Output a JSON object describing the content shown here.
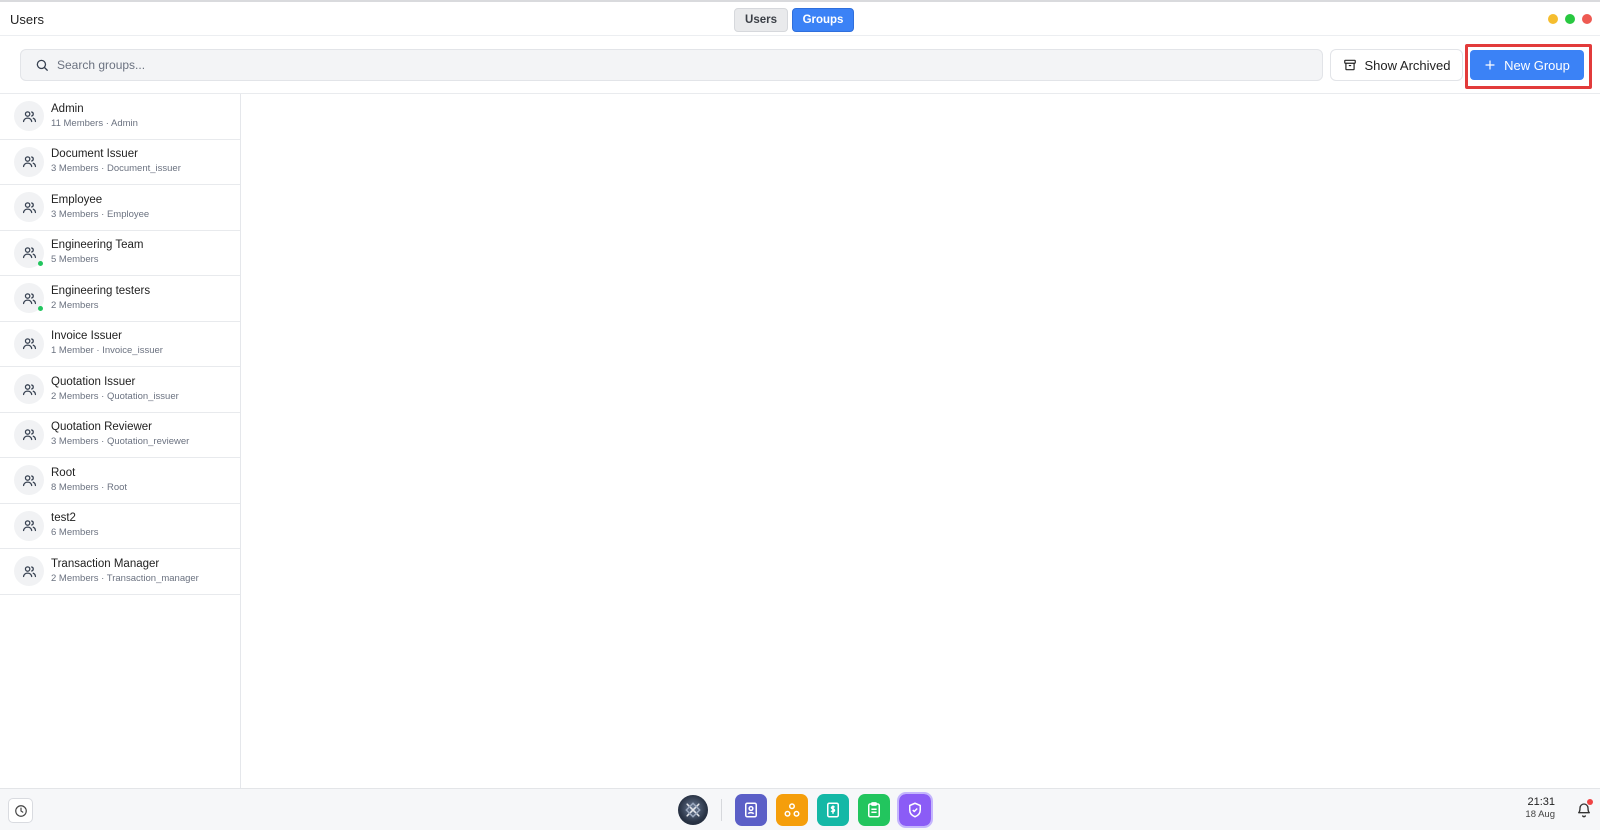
{
  "titlebar": {
    "app_title": "Users",
    "tabs": [
      {
        "label": "Users",
        "active": false
      },
      {
        "label": "Groups",
        "active": true
      }
    ],
    "window_controls": [
      {
        "name": "minimize",
        "color": "#f5bd2e"
      },
      {
        "name": "maximize",
        "color": "#28c840"
      },
      {
        "name": "close",
        "color": "#ee5a52"
      }
    ]
  },
  "toolbar": {
    "search_placeholder": "Search groups...",
    "search_value": "",
    "show_archived_label": "Show Archived",
    "new_group_label": "New Group",
    "accent_color": "#3b82f6",
    "highlight_color": "#e23b3b"
  },
  "groups": [
    {
      "name": "Admin",
      "sub": "11 Members · Admin",
      "online": false
    },
    {
      "name": "Document Issuer",
      "sub": "3 Members · Document_issuer",
      "online": false
    },
    {
      "name": "Employee",
      "sub": "3 Members · Employee",
      "online": false
    },
    {
      "name": "Engineering Team",
      "sub": "5 Members",
      "online": true
    },
    {
      "name": "Engineering testers",
      "sub": "2 Members",
      "online": true
    },
    {
      "name": "Invoice Issuer",
      "sub": "1 Member · Invoice_issuer",
      "online": false
    },
    {
      "name": "Quotation Issuer",
      "sub": "2 Members · Quotation_issuer",
      "online": false
    },
    {
      "name": "Quotation Reviewer",
      "sub": "3 Members · Quotation_reviewer",
      "online": false
    },
    {
      "name": "Root",
      "sub": "8 Members · Root",
      "online": false
    },
    {
      "name": "test2",
      "sub": "6 Members",
      "online": false
    },
    {
      "name": "Transaction Manager",
      "sub": "2 Members · Transaction_manager",
      "online": false
    }
  ],
  "taskbar": {
    "time": "21:31",
    "date": "18 Aug",
    "dock_apps": [
      {
        "icon": "contacts-app-icon",
        "color": "#5b5fc7"
      },
      {
        "icon": "network-app-icon",
        "color": "#f59e0b"
      },
      {
        "icon": "dollar-app-icon",
        "color": "#14b8a6"
      },
      {
        "icon": "clipboard-app-icon",
        "color": "#22c55e"
      },
      {
        "icon": "shield-app-icon",
        "color": "#8b5cf6"
      }
    ]
  }
}
